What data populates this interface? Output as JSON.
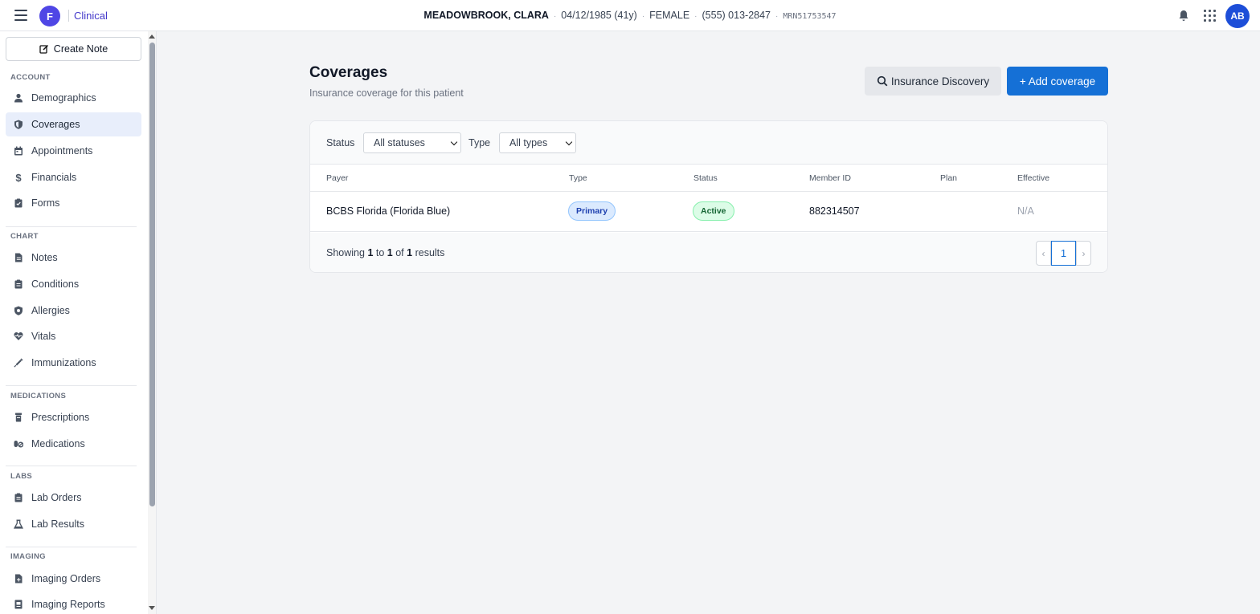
{
  "app": {
    "org_initial": "F",
    "name": "Clinical",
    "user_initials": "AB",
    "brand_color": "#4f46e5",
    "accent_color": "#1570d6"
  },
  "patient": {
    "name": "MEADOWBROOK, CLARA",
    "dob": "04/12/1985 (41y)",
    "sex": "FEMALE",
    "phone": "(555) 013-2847",
    "mrn": "MRN51753547"
  },
  "sidebar": {
    "create_note": "Create Note",
    "sections": [
      {
        "label": "ACCOUNT",
        "items": [
          {
            "label": "Demographics",
            "icon": "person-icon"
          },
          {
            "label": "Coverages",
            "icon": "shield-icon",
            "active": true
          },
          {
            "label": "Appointments",
            "icon": "calendar-icon"
          },
          {
            "label": "Financials",
            "icon": "dollar-icon"
          },
          {
            "label": "Forms",
            "icon": "clipboard-icon"
          }
        ]
      },
      {
        "label": "CHART",
        "items": [
          {
            "label": "Notes",
            "icon": "document-icon"
          },
          {
            "label": "Conditions",
            "icon": "clipboard-icon"
          },
          {
            "label": "Allergies",
            "icon": "shield-icon"
          },
          {
            "label": "Vitals",
            "icon": "heartbeat-icon"
          },
          {
            "label": "Immunizations",
            "icon": "syringe-icon"
          }
        ]
      },
      {
        "label": "MEDICATIONS",
        "items": [
          {
            "label": "Prescriptions",
            "icon": "prescription-bottle-icon"
          },
          {
            "label": "Medications",
            "icon": "pills-icon"
          }
        ]
      },
      {
        "label": "LABS",
        "items": [
          {
            "label": "Lab Orders",
            "icon": "clipboard-icon"
          },
          {
            "label": "Lab Results",
            "icon": "flask-icon"
          }
        ]
      },
      {
        "label": "IMAGING",
        "items": [
          {
            "label": "Imaging Orders",
            "icon": "document-icon"
          },
          {
            "label": "Imaging Reports",
            "icon": "report-icon"
          }
        ]
      }
    ]
  },
  "main": {
    "title": "Coverages",
    "subtitle": "Insurance coverage for this patient",
    "discovery_button": "Insurance Discovery",
    "add_button": "+ Add coverage",
    "filters": {
      "status_label": "Status",
      "status_value": "All statuses",
      "type_label": "Type",
      "type_value": "All types"
    },
    "table": {
      "columns": [
        "Payer",
        "Type",
        "Status",
        "Member ID",
        "Plan",
        "Effective"
      ],
      "rows": [
        {
          "payer": "BCBS Florida (Florida Blue)",
          "type": "Primary",
          "status": "Active",
          "member_id": "882314507",
          "plan": "",
          "effective": "N/A"
        }
      ]
    },
    "footer": {
      "showing_prefix": "Showing",
      "from": "1",
      "to_word": "to",
      "to": "1",
      "of_word": "of",
      "total": "1",
      "results_word": "results"
    },
    "pagination": {
      "prev": "‹",
      "current": "1",
      "next": "›"
    }
  }
}
